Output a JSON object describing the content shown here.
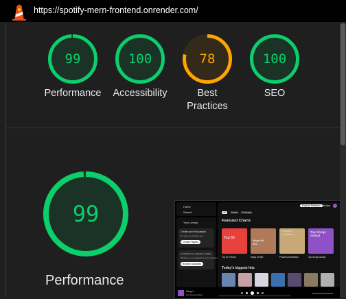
{
  "header": {
    "url": "https://spotify-mern-frontend.onrender.com/"
  },
  "colors": {
    "pass": "#0cce6b",
    "average": "#ffa400",
    "pass_bg": "#1a3326",
    "average_bg": "#332a1a"
  },
  "scores": [
    {
      "label": "Performance",
      "value": "99",
      "score": 99,
      "status": "pass"
    },
    {
      "label": "Accessibility",
      "value": "100",
      "score": 100,
      "status": "pass"
    },
    {
      "label_line1": "Best",
      "label_line2": "Practices",
      "value": "78",
      "score": 78,
      "status": "average"
    },
    {
      "label": "SEO",
      "value": "100",
      "score": 100,
      "status": "pass"
    }
  ],
  "main": {
    "value": "99",
    "score": 99,
    "label": "Performance"
  },
  "thumbnail": {
    "sidebar": {
      "home": "Home",
      "search": "Search",
      "library": "Your Library",
      "playlist_title": "Create your first playlist",
      "playlist_sub": "It's easy we will help you",
      "playlist_button": "Create Playlist",
      "podcast_title": "Let's find some podcasts to follow",
      "podcast_sub": "We'll keep you updated on new episodes",
      "podcast_button": "Browse podcasts"
    },
    "topnav": {
      "tab_all": "All",
      "tab_music": "Music",
      "tab_podcasts": "Podcasts",
      "premium": "Explore Premium",
      "install": "Install App"
    },
    "section_featured": "Featured Charts",
    "cards": [
      {
        "title": "Top 50",
        "caption": "Top 50 Poland",
        "color": "#e8403d"
      },
      {
        "title": "Mega Hit Mix",
        "caption": "Mega Hit Mix",
        "color": "#b07a5a"
      },
      {
        "title": "Peaceful Meditation",
        "caption": "Peaceful Meditation",
        "color": "#c9a877"
      },
      {
        "title": "Top Songs Global",
        "caption": "Top Songs Global",
        "color": "#8e52c6"
      }
    ],
    "section_hits": "Today's biggest hits",
    "player": {
      "song": "Song 1",
      "artist": "Top Songs Global"
    },
    "hit_colors": [
      "#6a86b0",
      "#c7a0a8",
      "#d6d6e0",
      "#3a6fb0",
      "#5a4a70",
      "#8a7a60",
      "#b0b0b0"
    ]
  }
}
